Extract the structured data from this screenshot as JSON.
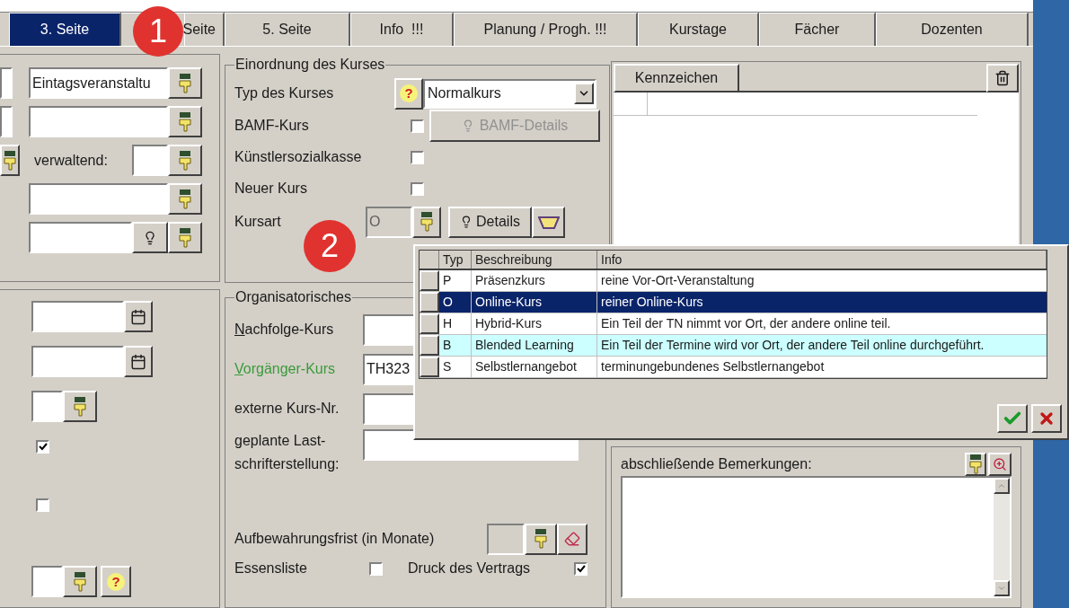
{
  "tabs": [
    {
      "label": "3. Seite",
      "selected": true
    },
    {
      "label": "Seite",
      "selected": false
    },
    {
      "label": "5. Seite",
      "selected": false
    },
    {
      "label": "Info  !!!",
      "selected": false
    },
    {
      "label": "Planung / Progh. !!!",
      "selected": false
    },
    {
      "label": "Kurstage",
      "selected": false
    },
    {
      "label": "Fächer",
      "selected": false
    },
    {
      "label": "Dozenten",
      "selected": false
    }
  ],
  "callouts": [
    "1",
    "2"
  ],
  "left_top": {
    "value": "Eintagsveranstaltu",
    "label": "verwaltend:"
  },
  "left_bottom": {
    "checks": [
      {
        "checked": true
      },
      {
        "checked": false
      }
    ],
    "help": "?"
  },
  "einordnung": {
    "title": "Einordnung des Kurses",
    "typ": {
      "label": "Typ des Kurses",
      "help": "?",
      "value": "Normalkurs"
    },
    "checks": [
      {
        "label": "BAMF-Kurs",
        "checked": false
      },
      {
        "label": "Künstlersozialkasse",
        "checked": false
      },
      {
        "label": "Neuer Kurs",
        "checked": false
      }
    ],
    "bamf_button": {
      "label": "BAMF-Details",
      "disabled": true
    },
    "kursart": {
      "label": "Kursart",
      "value": "O",
      "disabled": true,
      "details": "Details"
    }
  },
  "organisatorisches": {
    "title": "Organisatorisches",
    "fields": [
      {
        "label": "Nachfolge-Kurs",
        "linked": false
      },
      {
        "label": "Vorgänger-Kurs",
        "value": "TH323",
        "linked": true
      },
      {
        "label": "externe Kurs-Nr.",
        "linked": false
      },
      {
        "label": "geplante Last-\nschrifterstellung:",
        "linked": false
      }
    ],
    "aufbewahrung": "Aufbewahrungsfrist (in Monate)",
    "essensliste": {
      "label": "Essensliste",
      "checked": false
    },
    "druck": {
      "label": "Druck des Vertrags",
      "checked": true
    }
  },
  "kennzeichen": {
    "header": "Kennzeichen"
  },
  "bemerkungen": {
    "label": "abschließende Bemerkungen:"
  },
  "popup": {
    "columns": [
      "Typ",
      "Beschreibung",
      "Info"
    ],
    "rows": [
      {
        "typ": "P",
        "beschreibung": "Präsenzkurs",
        "info": "reine Vor-Ort-Veranstaltung",
        "selected": false,
        "highlighted": false
      },
      {
        "typ": "O",
        "beschreibung": "Online-Kurs",
        "info": "reiner Online-Kurs",
        "selected": true,
        "highlighted": false
      },
      {
        "typ": "H",
        "beschreibung": "Hybrid-Kurs",
        "info": "Ein Teil der TN nimmt vor Ort, der andere online teil.",
        "selected": false,
        "highlighted": false
      },
      {
        "typ": "B",
        "beschreibung": "Blended Learning",
        "info": "Ein Teil der Termine wird vor Ort, der andere Teil online durchgeführt.",
        "selected": false,
        "highlighted": true
      },
      {
        "typ": "S",
        "beschreibung": "Selbstlernangebot",
        "info": "terminungebundenes Selbstlernangebot",
        "selected": false,
        "highlighted": false
      }
    ]
  }
}
